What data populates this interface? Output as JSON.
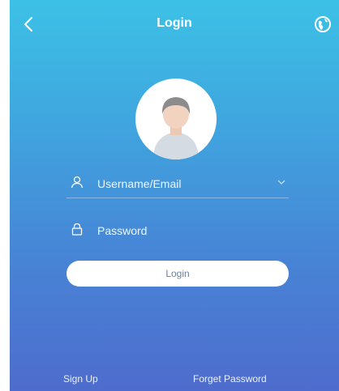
{
  "header": {
    "title": "Login",
    "back_icon": "chevron-left-icon",
    "globe_icon": "globe-icon"
  },
  "avatar": {
    "icon": "default-avatar-icon"
  },
  "form": {
    "username_placeholder": "Username/Email",
    "username_icon": "user-icon",
    "dropdown_icon": "chevron-down-icon",
    "password_placeholder": "Password",
    "password_icon": "lock-icon",
    "login_label": "Login"
  },
  "footer": {
    "sign_up_label": "Sign Up",
    "forgot_password_label": "Forget Password"
  },
  "colors": {
    "gradient_top": "#3cc1e6",
    "gradient_bottom": "#4e6ccd",
    "button_bg": "#ffffff"
  }
}
